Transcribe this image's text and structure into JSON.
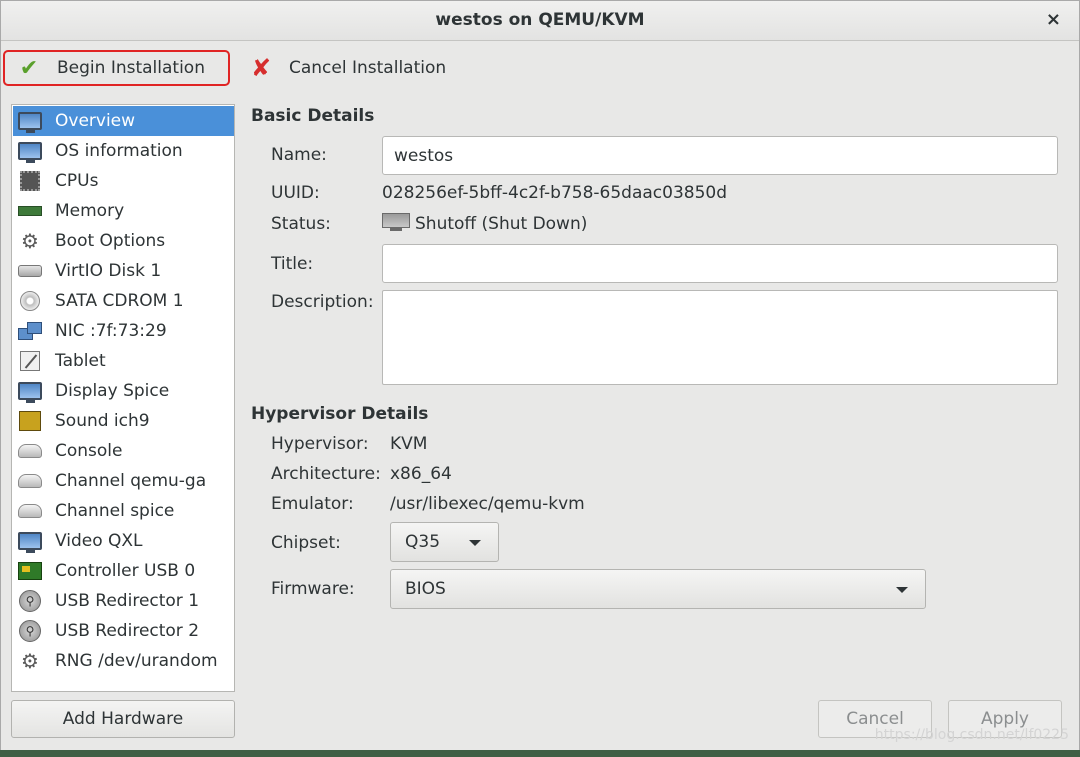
{
  "window": {
    "title": "westos on QEMU/KVM",
    "close_glyph": "×"
  },
  "toolbar": {
    "begin_label": "Begin Installation",
    "cancel_label": "Cancel Installation"
  },
  "sidebar": {
    "items": [
      {
        "label": "Overview",
        "icon": "monitor-icon",
        "selected": true
      },
      {
        "label": "OS information",
        "icon": "monitor-icon"
      },
      {
        "label": "CPUs",
        "icon": "cpu-chip-icon"
      },
      {
        "label": "Memory",
        "icon": "memory-icon"
      },
      {
        "label": "Boot Options",
        "icon": "gears-icon"
      },
      {
        "label": "VirtIO Disk 1",
        "icon": "disk-icon"
      },
      {
        "label": "SATA CDROM 1",
        "icon": "cdrom-icon"
      },
      {
        "label": "NIC :7f:73:29",
        "icon": "network-icon"
      },
      {
        "label": "Tablet",
        "icon": "tablet-icon"
      },
      {
        "label": "Display Spice",
        "icon": "monitor-icon"
      },
      {
        "label": "Sound ich9",
        "icon": "sound-card-icon"
      },
      {
        "label": "Console",
        "icon": "serial-icon"
      },
      {
        "label": "Channel qemu-ga",
        "icon": "serial-icon"
      },
      {
        "label": "Channel spice",
        "icon": "serial-icon"
      },
      {
        "label": "Video QXL",
        "icon": "monitor-icon"
      },
      {
        "label": "Controller USB 0",
        "icon": "usb-controller-icon"
      },
      {
        "label": "USB Redirector 1",
        "icon": "usb-icon"
      },
      {
        "label": "USB Redirector 2",
        "icon": "usb-icon"
      },
      {
        "label": "RNG /dev/urandom",
        "icon": "gears-icon"
      }
    ],
    "add_hardware_label": "Add Hardware"
  },
  "basic": {
    "section_title": "Basic Details",
    "name_label": "Name:",
    "name_value": "westos",
    "uuid_label": "UUID:",
    "uuid_value": "028256ef-5bff-4c2f-b758-65daac03850d",
    "status_label": "Status:",
    "status_value": "Shutoff (Shut Down)",
    "title_label": "Title:",
    "title_value": "",
    "description_label": "Description:",
    "description_value": ""
  },
  "hypervisor": {
    "section_title": "Hypervisor Details",
    "hypervisor_label": "Hypervisor:",
    "hypervisor_value": "KVM",
    "arch_label": "Architecture:",
    "arch_value": "x86_64",
    "emulator_label": "Emulator:",
    "emulator_value": "/usr/libexec/qemu-kvm",
    "chipset_label": "Chipset:",
    "chipset_value": "Q35",
    "firmware_label": "Firmware:",
    "firmware_value": "BIOS"
  },
  "footer": {
    "cancel_label": "Cancel",
    "apply_label": "Apply",
    "watermark": "https://blog.csdn.net/lf0225"
  },
  "colors": {
    "selection": "#4a90d9",
    "highlight_border": "#e02424",
    "check": "#5aa02c",
    "cancel_x": "#d62e2e"
  }
}
